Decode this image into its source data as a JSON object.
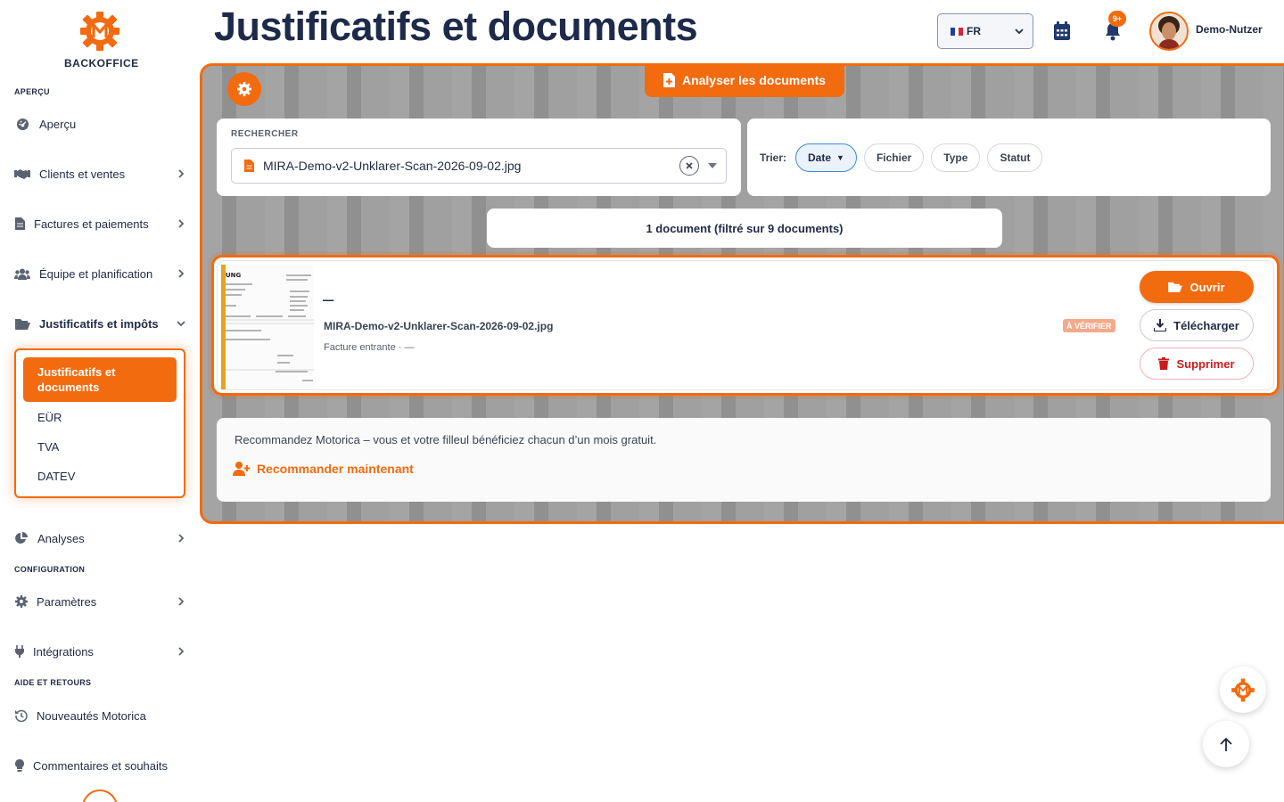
{
  "sidebar": {
    "brand": "BACKOFFICE",
    "sections": {
      "overview": "APERÇU",
      "config": "CONFIGURATION",
      "help": "AIDE ET RETOURS"
    },
    "items": [
      {
        "label": "Aperçu",
        "icon": "dashboard-icon"
      },
      {
        "label": "Clients et ventes",
        "icon": "handshake-icon"
      },
      {
        "label": "Factures et paiements",
        "icon": "invoice-icon"
      },
      {
        "label": "Équipe et planification",
        "icon": "team-icon"
      },
      {
        "label": "Justificatifs et impôts",
        "icon": "folder-open-icon"
      },
      {
        "label": "Analyses",
        "icon": "pie-chart-icon"
      },
      {
        "label": "Paramètres",
        "icon": "gear-icon"
      },
      {
        "label": "Intégrations",
        "icon": "plug-icon"
      },
      {
        "label": "Nouveautés Motorica",
        "icon": "history-icon"
      },
      {
        "label": "Commentaires et souhaits",
        "icon": "lightbulb-icon"
      }
    ],
    "submenu": {
      "active": "Justificatifs et documents",
      "items": [
        "EÜR",
        "TVA",
        "DATEV"
      ]
    }
  },
  "header": {
    "title": "Justificatifs et documents",
    "language": "FR",
    "notification_count": "9+",
    "user_name": "Demo-Nutzer"
  },
  "main": {
    "analyze_button": "Analyser les documents",
    "search": {
      "label": "RECHERCHER",
      "value": "MIRA-Demo-v2-Unklarer-Scan-2026-09-02.jpg"
    },
    "sort": {
      "label": "Trier:",
      "options": [
        "Date",
        "Fichier",
        "Type",
        "Statut"
      ],
      "active": "Date"
    },
    "result_count": "1 document (filtré sur 9 documents)",
    "document": {
      "title": "–",
      "filename": "MIRA-Demo-v2-Unklarer-Scan-2026-09-02.jpg",
      "meta": "Facture entrante · —",
      "status": "À VÉRIFIER",
      "actions": {
        "open": "Ouvrir",
        "download": "Télécharger",
        "delete": "Supprimer"
      }
    },
    "referral": {
      "text": "Recommandez Motorica – vous et votre filleul bénéficiez chacun d’un mois gratuit.",
      "link": "Recommander maintenant"
    }
  },
  "colors": {
    "accent": "#f26b0f",
    "navy": "#1e2a4a",
    "danger": "#c81d1d",
    "status_badge": "#f4a98a"
  }
}
